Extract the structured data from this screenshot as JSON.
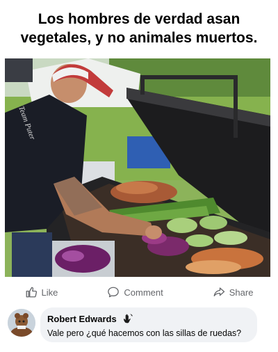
{
  "caption": {
    "text": "Los hombres de verdad asan vegetales, y no animales muertos."
  },
  "photo": {
    "shirt_print": "Team Puter",
    "description_icon": "grill-photo"
  },
  "actions": {
    "like_label": "Like",
    "comment_label": "Comment",
    "share_label": "Share"
  },
  "comment": {
    "author": "Robert Edwards",
    "text": "Vale pero ¿qué hacemos con las sillas de ruedas?",
    "badge_icon": "waving-hand-icon"
  },
  "colors": {
    "action_gray": "#65676b",
    "bubble_bg": "#f0f2f5"
  }
}
